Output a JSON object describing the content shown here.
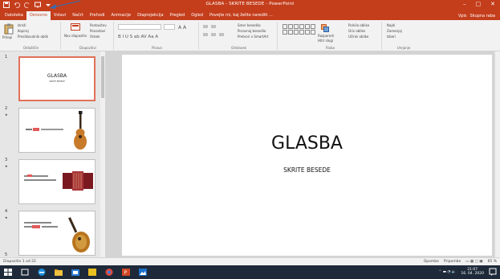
{
  "window": {
    "title": "GLASBA - SKRITE BESEDE - PowerPoint",
    "controls": [
      "–",
      "□",
      "✕"
    ],
    "account": "Vpis",
    "share": "Skupna raba"
  },
  "tabs": [
    {
      "label": "Datoteka",
      "active": false
    },
    {
      "label": "Osnovno",
      "active": true
    },
    {
      "label": "Vstavi",
      "active": false
    },
    {
      "label": "Načrt",
      "active": false
    },
    {
      "label": "Prehodi",
      "active": false
    },
    {
      "label": "Animacije",
      "active": false
    },
    {
      "label": "Diaprojekcija",
      "active": false
    },
    {
      "label": "Pregled",
      "active": false
    },
    {
      "label": "Ogled",
      "active": false
    },
    {
      "label": "Povejte mi, kaj želite narediti ...",
      "active": false
    }
  ],
  "ribbon": {
    "clipboard": {
      "paste": "Prilepi",
      "cut": "Izreži",
      "copy": "Kopiraj",
      "format_painter": "Preslikovalnik oblik",
      "label": "Odložišče"
    },
    "slides": {
      "new_slide": "Nov diapozitiv",
      "layout": "Postavitev",
      "reset": "Ponastavi",
      "section": "Odsek",
      "label": "Diapozitivi"
    },
    "font": {
      "label": "Pisava"
    },
    "paragraph": {
      "text_direction": "Smer besedila",
      "align_text": "Poravnaj besedilo",
      "smartart": "Pretvori v SmartArt",
      "label": "Odstavek"
    },
    "drawing": {
      "arrange": "Razporedi",
      "quick_styles": "Hitri slogi",
      "fill": "Polnilo oblike",
      "outline": "Oris oblike",
      "effects": "Učinki oblike",
      "label": "Risba"
    },
    "editing": {
      "find": "Najdi",
      "replace": "Zamenjaj",
      "select": "Izberi",
      "label": "Urejanje"
    }
  },
  "thumbnails": [
    {
      "num": "1",
      "title": "GLASBA",
      "sub": "SKRITE BESEDE"
    },
    {
      "num": "2"
    },
    {
      "num": "3"
    },
    {
      "num": "4"
    },
    {
      "num": "5"
    }
  ],
  "slide": {
    "title": "GLASBA",
    "subtitle": "SKRITE BESEDE"
  },
  "status": {
    "slide_of": "Diapozitiv 1 od 22",
    "notes": "Opombe",
    "comments": "Pripombe",
    "zoom": "65 %"
  },
  "taskbar": {
    "time": "21:07",
    "date": "16. 04. 2020"
  },
  "colors": {
    "accent": "#c43e1c",
    "selected_thumb": "#e0715a"
  }
}
